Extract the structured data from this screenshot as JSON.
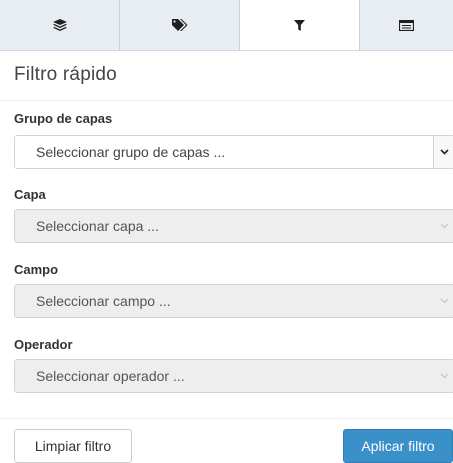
{
  "tabs": [
    {
      "icon": "layers-icon"
    },
    {
      "icon": "tags-icon"
    },
    {
      "icon": "filter-icon",
      "active": true
    },
    {
      "icon": "list-icon"
    }
  ],
  "panel": {
    "title": "Filtro rápido"
  },
  "fields": {
    "layer_group": {
      "label": "Grupo de capas",
      "placeholder": "Seleccionar grupo de capas ..."
    },
    "layer": {
      "label": "Capa",
      "placeholder": "Seleccionar capa ..."
    },
    "field": {
      "label": "Campo",
      "placeholder": "Seleccionar campo ..."
    },
    "operator": {
      "label": "Operador",
      "placeholder": "Seleccionar operador ..."
    }
  },
  "buttons": {
    "clear": "Limpiar filtro",
    "apply": "Aplicar filtro"
  },
  "colors": {
    "tab_bar": "#e8ecf3",
    "apply_button": "#3a90c9",
    "disabled_field": "#eeeeee"
  }
}
